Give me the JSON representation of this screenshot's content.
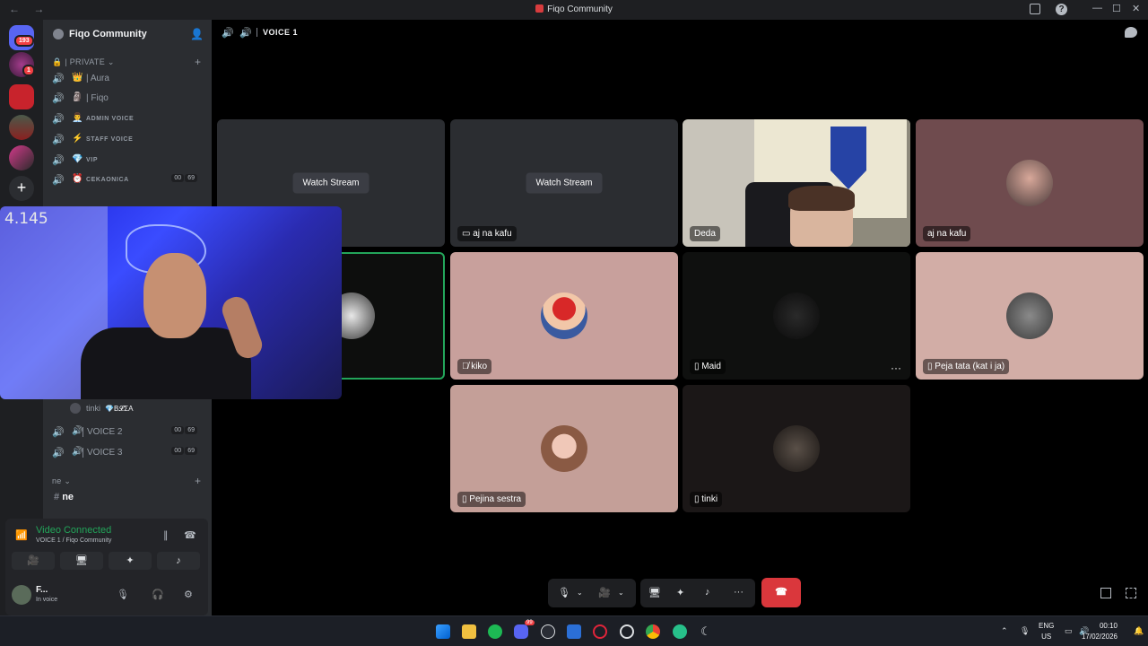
{
  "window": {
    "title": "Fiqo Community"
  },
  "server": {
    "name": "Fiqo Community"
  },
  "guilds": {
    "dm_badge": "193",
    "second_badge": "1"
  },
  "categories": [
    {
      "label": "| PRIVATE"
    },
    {
      "label": "ne"
    }
  ],
  "channels": [
    {
      "emoji": "👑",
      "name": "| Aura",
      "small": false
    },
    {
      "emoji": "🗿",
      "name": "| Fiqo",
      "small": false
    },
    {
      "emoji": "👨‍💼",
      "name": "ADMIN VOICE",
      "small": true
    },
    {
      "emoji": "⚡",
      "name": "STAFF VOICE",
      "small": true
    },
    {
      "emoji": "💎",
      "name": "VIP",
      "small": true
    },
    {
      "emoji": "⏰",
      "name": "CEKAONICA",
      "small": true,
      "count_a": "00",
      "count_b": "69"
    }
  ],
  "voice_user": {
    "name": "tinki",
    "tag": "💎B𝓛ΣA"
  },
  "lower_channels": [
    {
      "name": "VOICE 2",
      "count_a": "00",
      "count_b": "69"
    },
    {
      "name": "VOICE 3",
      "count_a": "00",
      "count_b": "69"
    }
  ],
  "text_channel": {
    "name": "ne"
  },
  "user_panel": {
    "status": "Video Connected",
    "sub": "VOICE 1 / Fiqo Community",
    "name": "F...",
    "presence": "In voice"
  },
  "voice_header": {
    "title": "VOICE 1"
  },
  "tiles": [
    {
      "label": "",
      "watch": "Watch Stream",
      "bg": "#2b2d31"
    },
    {
      "label": "aj na kafu",
      "watch": "Watch Stream",
      "bg": "#2b2d31"
    },
    {
      "label": "Deda",
      "bg": "#c8c4ba"
    },
    {
      "label": "aj na kafu",
      "bg": "#6f4b4e"
    },
    {
      "label": "",
      "bg": "#0d0e0d"
    },
    {
      "label": "kiko",
      "bg": "#c8a09c"
    },
    {
      "label": "Maid",
      "bg": "#0f100f",
      "more": "···"
    },
    {
      "label": "Peja tata (kat i ja)",
      "bg": "#d2ada6"
    },
    {
      "label": "Pejina sestra",
      "bg": "#c49f98"
    },
    {
      "label": "tinki",
      "bg": "#1b1717"
    }
  ],
  "overlay": {
    "counter": "4.145"
  },
  "call_controls": {
    "hangup_icon": "phone-hangup-icon"
  },
  "taskbar": {
    "discord_badge": "99",
    "lang_line1": "ENG",
    "lang_line2": "US",
    "time": "00:10",
    "date": "17/02/2026"
  },
  "colors": {
    "accent_green": "#23a55a",
    "hangup_red": "#da373c",
    "focus_green": "#23a55a"
  }
}
